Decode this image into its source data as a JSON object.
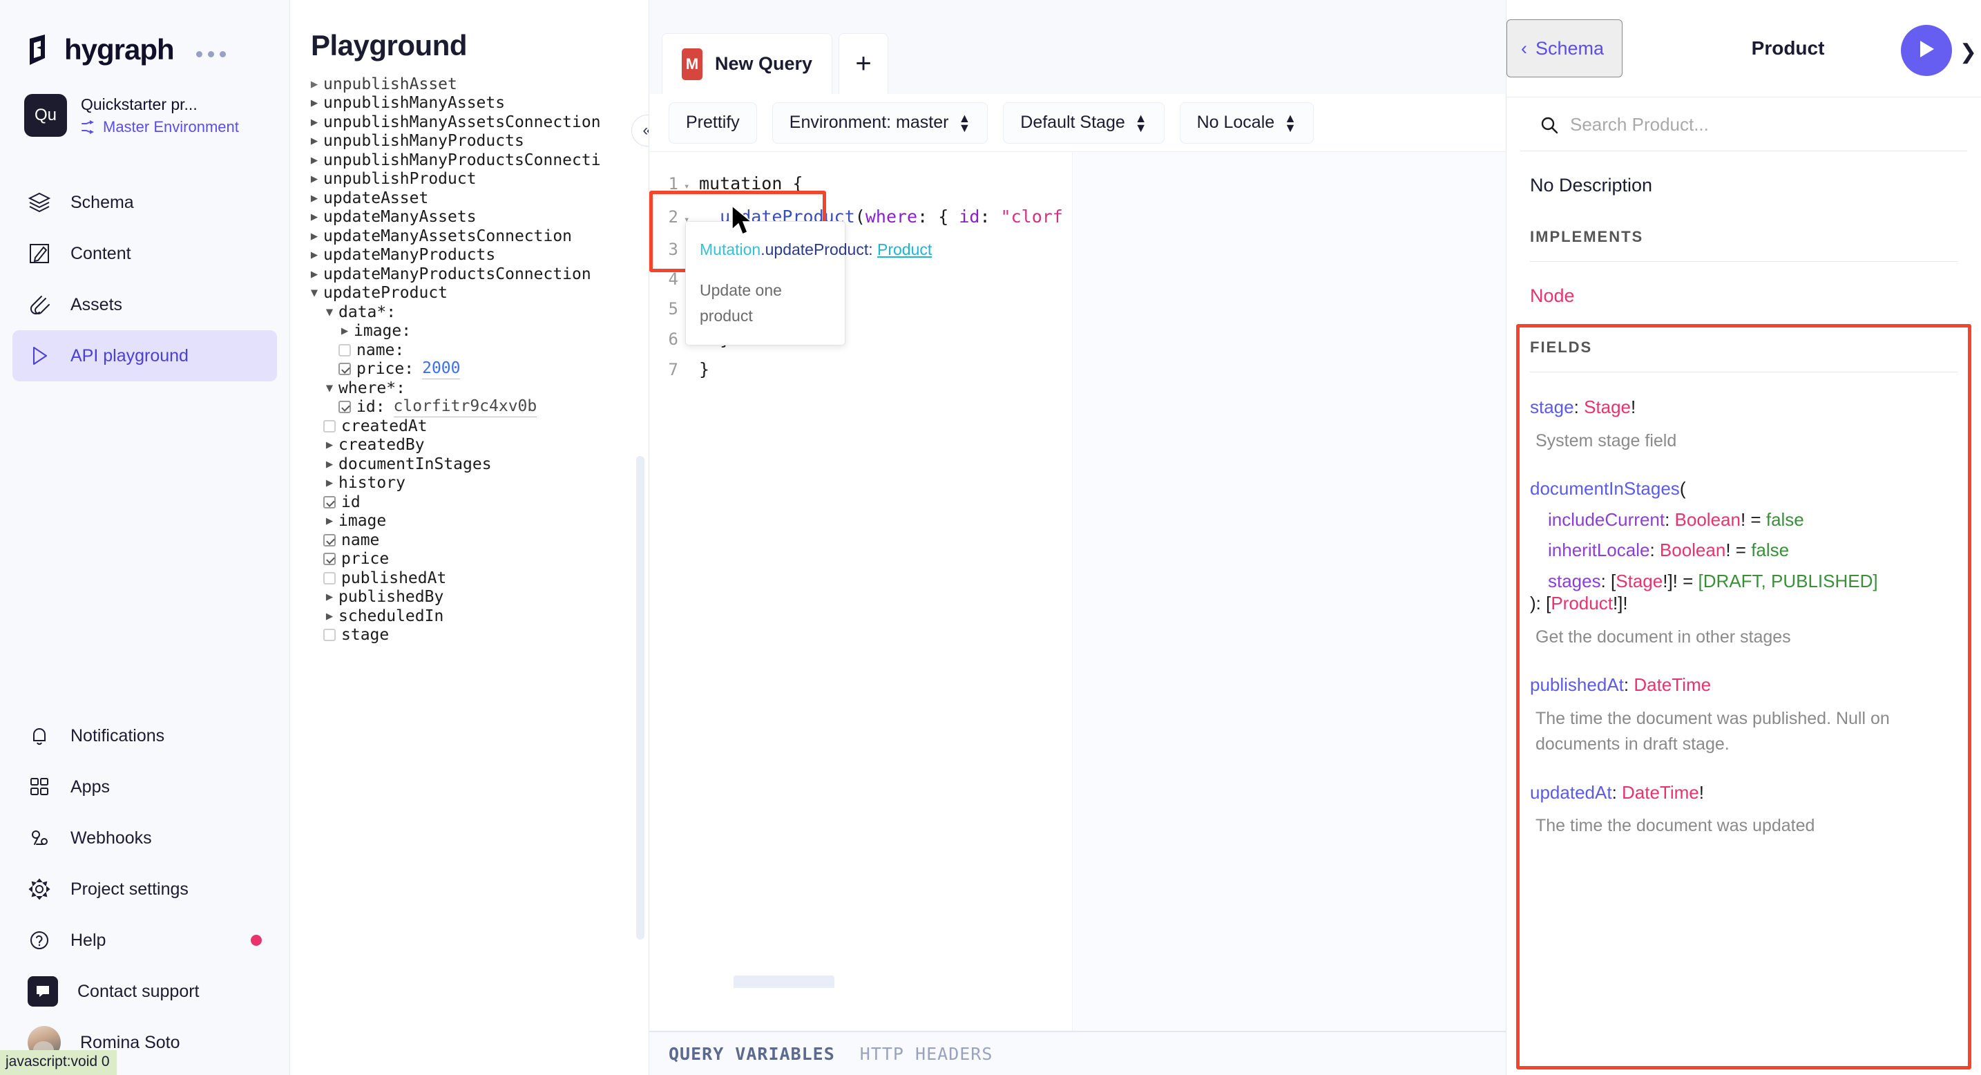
{
  "brand": {
    "name": "hygraph",
    "menu_icon": "ellipsis-icon"
  },
  "project": {
    "avatar_initials": "Qu",
    "name": "Quickstarter pr...",
    "environment": "Master Environment"
  },
  "nav": {
    "primary": [
      {
        "label": "Schema",
        "icon": "layers-icon",
        "active": false
      },
      {
        "label": "Content",
        "icon": "edit-square-icon",
        "active": false
      },
      {
        "label": "Assets",
        "icon": "paperclip-icon",
        "active": false
      },
      {
        "label": "API playground",
        "icon": "play-triangle-icon",
        "active": true
      }
    ],
    "secondary": [
      {
        "label": "Notifications",
        "icon": "bell-icon"
      },
      {
        "label": "Apps",
        "icon": "grid-icon"
      },
      {
        "label": "Webhooks",
        "icon": "webhook-icon"
      },
      {
        "label": "Project settings",
        "icon": "gear-icon"
      },
      {
        "label": "Help",
        "icon": "question-circle-icon",
        "badge": true
      }
    ],
    "support": {
      "label": "Contact support",
      "icon": "chat-icon"
    },
    "user": {
      "label": "Romina Soto",
      "icon": "avatar"
    }
  },
  "status_bar": {
    "text": "javascript:void 0"
  },
  "explorer": {
    "title": "Playground",
    "collapse_icon": "chevron-double-left-icon",
    "nodes": [
      {
        "indent": 0,
        "marker": "caret-right",
        "label": "unpublishAsset",
        "clipped": true
      },
      {
        "indent": 0,
        "marker": "caret-right",
        "label": "unpublishManyAssets"
      },
      {
        "indent": 0,
        "marker": "caret-right",
        "label": "unpublishManyAssetsConnection"
      },
      {
        "indent": 0,
        "marker": "caret-right",
        "label": "unpublishManyProducts"
      },
      {
        "indent": 0,
        "marker": "caret-right",
        "label": "unpublishManyProductsConnecti"
      },
      {
        "indent": 0,
        "marker": "caret-right",
        "label": "unpublishProduct"
      },
      {
        "indent": 0,
        "marker": "caret-right",
        "label": "updateAsset"
      },
      {
        "indent": 0,
        "marker": "caret-right",
        "label": "updateManyAssets"
      },
      {
        "indent": 0,
        "marker": "caret-right",
        "label": "updateManyAssetsConnection"
      },
      {
        "indent": 0,
        "marker": "caret-right",
        "label": "updateManyProducts"
      },
      {
        "indent": 0,
        "marker": "caret-right",
        "label": "updateManyProductsConnection"
      },
      {
        "indent": 0,
        "marker": "caret-down",
        "label": "updateProduct"
      },
      {
        "indent": 1,
        "marker": "caret-down",
        "label": "data*:"
      },
      {
        "indent": 2,
        "marker": "caret-right",
        "label": "image:"
      },
      {
        "indent": 2,
        "marker": "checkbox-light",
        "label": "name:"
      },
      {
        "indent": 2,
        "marker": "checkbox-checked",
        "label": "price:",
        "value": "2000",
        "value_color": "blue"
      },
      {
        "indent": 1,
        "marker": "caret-down",
        "label": "where*:"
      },
      {
        "indent": 2,
        "marker": "checkbox-checked",
        "label": "id:",
        "value": "clorfitr9c4xv0b",
        "value_color": "gray"
      },
      {
        "indent": 1,
        "marker": "checkbox-light",
        "label": "createdAt"
      },
      {
        "indent": 1,
        "marker": "caret-right",
        "label": "createdBy"
      },
      {
        "indent": 1,
        "marker": "caret-right",
        "label": "documentInStages"
      },
      {
        "indent": 1,
        "marker": "caret-right",
        "label": "history"
      },
      {
        "indent": 1,
        "marker": "checkbox-checked",
        "label": "id"
      },
      {
        "indent": 1,
        "marker": "caret-right",
        "label": "image"
      },
      {
        "indent": 1,
        "marker": "checkbox-checked",
        "label": "name"
      },
      {
        "indent": 1,
        "marker": "checkbox-checked",
        "label": "price"
      },
      {
        "indent": 1,
        "marker": "checkbox-light",
        "label": "publishedAt"
      },
      {
        "indent": 1,
        "marker": "caret-right",
        "label": "publishedBy"
      },
      {
        "indent": 1,
        "marker": "caret-right",
        "label": "scheduledIn"
      },
      {
        "indent": 1,
        "marker": "checkbox-light",
        "label": "stage"
      }
    ]
  },
  "tabs": {
    "items": [
      {
        "badge": "M",
        "label": "New Query",
        "active": true
      }
    ],
    "add_label": "+"
  },
  "toolbar": {
    "prettify": "Prettify",
    "environment": "Environment: master",
    "stage": "Default Stage",
    "locale": "No Locale"
  },
  "editor": {
    "lines": [
      {
        "num": "1",
        "fold": "▾",
        "tokens": [
          {
            "t": "mutation {",
            "c": "kw"
          }
        ]
      },
      {
        "num": "2",
        "fold": "▾",
        "tokens": [
          {
            "t": "  ",
            "c": "kw"
          },
          {
            "t": "updateProduct",
            "c": "fld"
          },
          {
            "t": "(",
            "c": "punct"
          },
          {
            "t": "where",
            "c": "arg"
          },
          {
            "t": ": { ",
            "c": "punct"
          },
          {
            "t": "id",
            "c": "arg"
          },
          {
            "t": ": ",
            "c": "punct"
          },
          {
            "t": "\"clorf",
            "c": "str"
          }
        ]
      },
      {
        "num": "3",
        "fold": "",
        "tokens": []
      },
      {
        "num": "4",
        "fold": "",
        "tokens": []
      },
      {
        "num": "5",
        "fold": "",
        "tokens": []
      },
      {
        "num": "6",
        "fold": "",
        "tokens": [
          {
            "t": "  }",
            "c": "kw"
          }
        ]
      },
      {
        "num": "7",
        "fold": "",
        "tokens": [
          {
            "t": "}",
            "c": "kw"
          }
        ]
      }
    ],
    "tooltip": {
      "owner": "Mutation",
      "separator": ".",
      "field": "updateProduct",
      "colon": ": ",
      "return_type": "Product",
      "description": "Update one product"
    },
    "cursor_icon": "mouse-pointer-icon"
  },
  "bottom_tabs": [
    {
      "label": "QUERY VARIABLES",
      "active": true
    },
    {
      "label": "HTTP HEADERS",
      "active": false
    }
  ],
  "docs": {
    "back_label": "Schema",
    "back_icon": "chevron-left-icon",
    "title": "Product",
    "run_icon": "play-icon",
    "collapse_icon": "chevron-right-icon",
    "search_placeholder": "Search Product...",
    "search_icon": "search-icon",
    "no_description": "No Description",
    "implements_label": "IMPLEMENTS",
    "implements": [
      "Node"
    ],
    "fields_label": "FIELDS",
    "fields": [
      {
        "name": "stage",
        "sig_suffix": ": ",
        "type": "Stage",
        "bang": "!",
        "args": [],
        "description": "System stage field"
      },
      {
        "name": "documentInStages",
        "open_paren": "(",
        "args": [
          {
            "name": "includeCurrent",
            "sep": ": ",
            "type": "Boolean",
            "bang": "!",
            "eq": " = ",
            "default": "false"
          },
          {
            "name": "inheritLocale",
            "sep": ": ",
            "type": "Boolean",
            "bang": "!",
            "eq": " = ",
            "default": "false"
          },
          {
            "name": "stages",
            "sep": ": [",
            "type": "Stage",
            "bang": "!]!",
            "eq": " = ",
            "default": "[DRAFT, PUBLISHED]"
          }
        ],
        "close": "): [",
        "ret_type": "Product",
        "ret_bang": "!]!",
        "description": "Get the document in other stages"
      },
      {
        "name": "publishedAt",
        "sig_suffix": ": ",
        "type": "DateTime",
        "bang": "",
        "args": [],
        "description": "The time the document was published. Null on documents in draft stage."
      },
      {
        "name": "updatedAt",
        "sig_suffix": ": ",
        "type": "DateTime",
        "bang": "!",
        "args": [],
        "description": "The time the document was updated"
      }
    ]
  },
  "colors": {
    "accent": "#5b4ee6",
    "run": "#655ef0",
    "highlight_box": "#f2452b",
    "tab_badge": "#d6463d",
    "badge_dot": "#e8336d",
    "type_pink": "#e8336d",
    "field_blue": "#5b5be8",
    "arg_purple": "#8a3fd6",
    "default_green": "#3a8f3a"
  }
}
